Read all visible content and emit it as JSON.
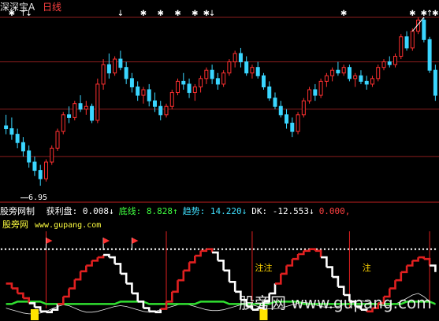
{
  "header": {
    "app_name": "深深宝A",
    "period": "日线"
  },
  "price_chart": {
    "low_label": "6.95",
    "colors": {
      "up": "#ff3030",
      "down": "#3ad6ff",
      "grid": "#8a1e1e",
      "marker": "#ffffff"
    },
    "price_range": [
      6.5,
      13.0
    ],
    "price_grid": [
      8.0,
      9.7,
      11.4,
      13.0
    ],
    "candles": [
      [
        9.1,
        9.5,
        8.8,
        9.0
      ],
      [
        9.0,
        9.4,
        8.6,
        8.8
      ],
      [
        8.8,
        9.0,
        8.3,
        8.5
      ],
      [
        8.5,
        8.7,
        8.0,
        8.2
      ],
      [
        8.2,
        8.4,
        7.6,
        7.8
      ],
      [
        7.8,
        8.0,
        7.3,
        7.5
      ],
      [
        7.5,
        7.7,
        6.95,
        7.2
      ],
      [
        7.2,
        7.9,
        7.1,
        7.8
      ],
      [
        7.8,
        8.4,
        7.7,
        8.3
      ],
      [
        8.3,
        9.0,
        8.2,
        8.9
      ],
      [
        8.9,
        9.6,
        8.8,
        9.5
      ],
      [
        9.5,
        9.8,
        9.2,
        9.4
      ],
      [
        9.4,
        10.0,
        9.3,
        9.9
      ],
      [
        9.9,
        10.2,
        9.6,
        9.7
      ],
      [
        9.7,
        10.0,
        9.5,
        9.8
      ],
      [
        9.8,
        9.9,
        9.2,
        9.3
      ],
      [
        9.3,
        10.8,
        9.2,
        10.6
      ],
      [
        10.6,
        11.5,
        10.4,
        11.3
      ],
      [
        11.3,
        11.7,
        10.8,
        11.0
      ],
      [
        11.0,
        11.6,
        10.9,
        11.5
      ],
      [
        11.5,
        11.8,
        11.1,
        11.2
      ],
      [
        11.2,
        11.4,
        10.6,
        10.8
      ],
      [
        10.8,
        11.0,
        10.3,
        10.5
      ],
      [
        10.5,
        10.7,
        10.0,
        10.2
      ],
      [
        10.2,
        10.5,
        9.9,
        10.4
      ],
      [
        10.4,
        10.6,
        9.8,
        10.0
      ],
      [
        10.0,
        10.3,
        9.6,
        9.8
      ],
      [
        9.8,
        10.0,
        9.3,
        9.5
      ],
      [
        9.5,
        9.9,
        9.4,
        9.8
      ],
      [
        9.8,
        10.4,
        9.7,
        10.3
      ],
      [
        10.3,
        10.8,
        10.2,
        10.7
      ],
      [
        10.7,
        11.0,
        10.4,
        10.6
      ],
      [
        10.6,
        10.8,
        10.1,
        10.3
      ],
      [
        10.3,
        10.6,
        10.0,
        10.5
      ],
      [
        10.5,
        10.9,
        10.3,
        10.8
      ],
      [
        10.8,
        11.2,
        10.6,
        11.1
      ],
      [
        11.1,
        11.3,
        10.6,
        10.8
      ],
      [
        10.8,
        11.0,
        10.4,
        10.6
      ],
      [
        10.6,
        11.1,
        10.5,
        11.0
      ],
      [
        11.0,
        11.5,
        10.9,
        11.4
      ],
      [
        11.4,
        11.8,
        11.2,
        11.7
      ],
      [
        11.7,
        11.9,
        11.2,
        11.4
      ],
      [
        11.4,
        11.6,
        10.9,
        11.0
      ],
      [
        11.0,
        11.3,
        10.8,
        11.2
      ],
      [
        11.2,
        11.4,
        10.8,
        10.9
      ],
      [
        10.9,
        11.0,
        10.4,
        10.5
      ],
      [
        10.5,
        10.7,
        10.0,
        10.1
      ],
      [
        10.1,
        10.3,
        9.7,
        9.8
      ],
      [
        9.8,
        10.0,
        9.4,
        9.5
      ],
      [
        9.5,
        9.7,
        9.0,
        9.2
      ],
      [
        9.2,
        9.4,
        8.7,
        8.9
      ],
      [
        8.9,
        9.6,
        8.8,
        9.5
      ],
      [
        9.5,
        10.1,
        9.4,
        10.0
      ],
      [
        10.0,
        10.5,
        9.9,
        10.4
      ],
      [
        10.4,
        10.6,
        10.0,
        10.2
      ],
      [
        10.2,
        10.8,
        10.1,
        10.7
      ],
      [
        10.7,
        11.0,
        10.5,
        10.9
      ],
      [
        10.9,
        11.2,
        10.7,
        11.1
      ],
      [
        11.1,
        11.4,
        10.9,
        11.0
      ],
      [
        11.0,
        11.3,
        10.9,
        11.2
      ],
      [
        11.2,
        11.3,
        10.7,
        10.8
      ],
      [
        10.8,
        11.0,
        10.5,
        10.9
      ],
      [
        10.9,
        11.1,
        10.6,
        10.7
      ],
      [
        10.7,
        10.9,
        10.4,
        10.6
      ],
      [
        10.6,
        10.9,
        10.5,
        10.8
      ],
      [
        10.8,
        11.3,
        10.7,
        11.2
      ],
      [
        11.2,
        11.5,
        11.1,
        11.4
      ],
      [
        11.4,
        11.6,
        11.2,
        11.3
      ],
      [
        11.3,
        11.7,
        11.2,
        11.6
      ],
      [
        11.6,
        12.4,
        11.5,
        12.3
      ],
      [
        12.3,
        12.5,
        11.8,
        11.9
      ],
      [
        11.9,
        12.6,
        11.8,
        12.5
      ],
      [
        12.5,
        13.0,
        12.4,
        12.9
      ],
      [
        12.9,
        13.0,
        12.1,
        12.2
      ],
      [
        12.2,
        12.3,
        11.0,
        11.1
      ],
      [
        11.1,
        11.3,
        10.0,
        10.2
      ]
    ],
    "top_star_slots": [
      1,
      24,
      27,
      30,
      33,
      35,
      59,
      71,
      73,
      75,
      77
    ],
    "up_arrow_slots": [
      3,
      74
    ],
    "down_arrow_slots": [
      4,
      20,
      36
    ]
  },
  "indicator": {
    "name": "股旁网制",
    "items": [
      {
        "label": "获利盘:",
        "value": "0.008",
        "arrow": "↓",
        "color": "#ffffff"
      },
      {
        "label": "底线:",
        "value": "8.828",
        "arrow": "↑",
        "color": "#40ff40"
      },
      {
        "label": "趋势:",
        "value": "14.220",
        "arrow": "↓",
        "color": "#40e0ff"
      },
      {
        "label": "DK:",
        "value": "-12.553",
        "arrow": "↓",
        "color": "#ffffff"
      },
      {
        "label": "",
        "value": "0.000,",
        "arrow": "",
        "color": "#ff4040"
      }
    ],
    "site_name": "股旁网",
    "site_url": "www.gupang.com",
    "range": [
      0,
      100
    ],
    "dotted_level": 82,
    "green_baseline": 15,
    "trend_white": [
      40,
      34,
      28,
      22,
      16,
      11,
      6,
      5,
      8,
      15,
      24,
      34,
      45,
      55,
      62,
      68,
      72,
      75,
      72,
      64,
      52,
      40,
      28,
      18,
      10,
      6,
      5,
      9,
      18,
      30,
      44,
      56,
      66,
      74,
      80,
      82,
      78,
      68,
      56,
      42,
      30,
      20,
      12,
      8,
      10,
      18,
      28,
      40,
      52,
      62,
      70,
      76,
      80,
      82,
      80,
      72,
      60,
      48,
      36,
      26,
      18,
      12,
      8,
      6,
      10,
      16,
      24,
      34,
      44,
      54,
      62,
      68,
      72,
      70,
      62,
      54
    ],
    "profit_red_segments": [
      [
        0,
        4
      ],
      [
        10,
        17
      ],
      [
        28,
        36
      ],
      [
        48,
        55
      ],
      [
        64,
        74
      ]
    ],
    "thin_line": [
      10,
      8,
      6,
      4,
      3,
      3,
      4,
      6,
      9,
      12,
      14,
      13,
      10,
      7,
      5,
      5,
      6,
      8,
      10,
      12,
      13,
      12,
      10,
      8,
      6,
      5,
      6,
      8,
      10,
      12,
      14,
      15,
      14,
      12,
      10,
      8,
      7,
      7,
      8,
      10,
      12,
      14,
      15,
      14,
      12,
      10,
      9,
      9,
      10,
      12,
      14,
      16,
      17,
      16,
      14,
      12,
      11,
      11,
      12,
      14,
      16,
      18,
      19,
      18,
      16,
      14,
      13,
      13,
      15,
      18,
      22,
      26,
      28,
      24,
      18,
      14
    ],
    "red_vlines": [
      7,
      28,
      43,
      60,
      74
    ],
    "red_flags": [
      7,
      17,
      22
    ],
    "yellow_markers": [
      5,
      45
    ],
    "yellow_labels": [
      {
        "slot": 45,
        "text": "注注"
      },
      {
        "slot": 63,
        "text": "注"
      }
    ]
  },
  "watermark": "股旁网  www.gupang.com"
}
